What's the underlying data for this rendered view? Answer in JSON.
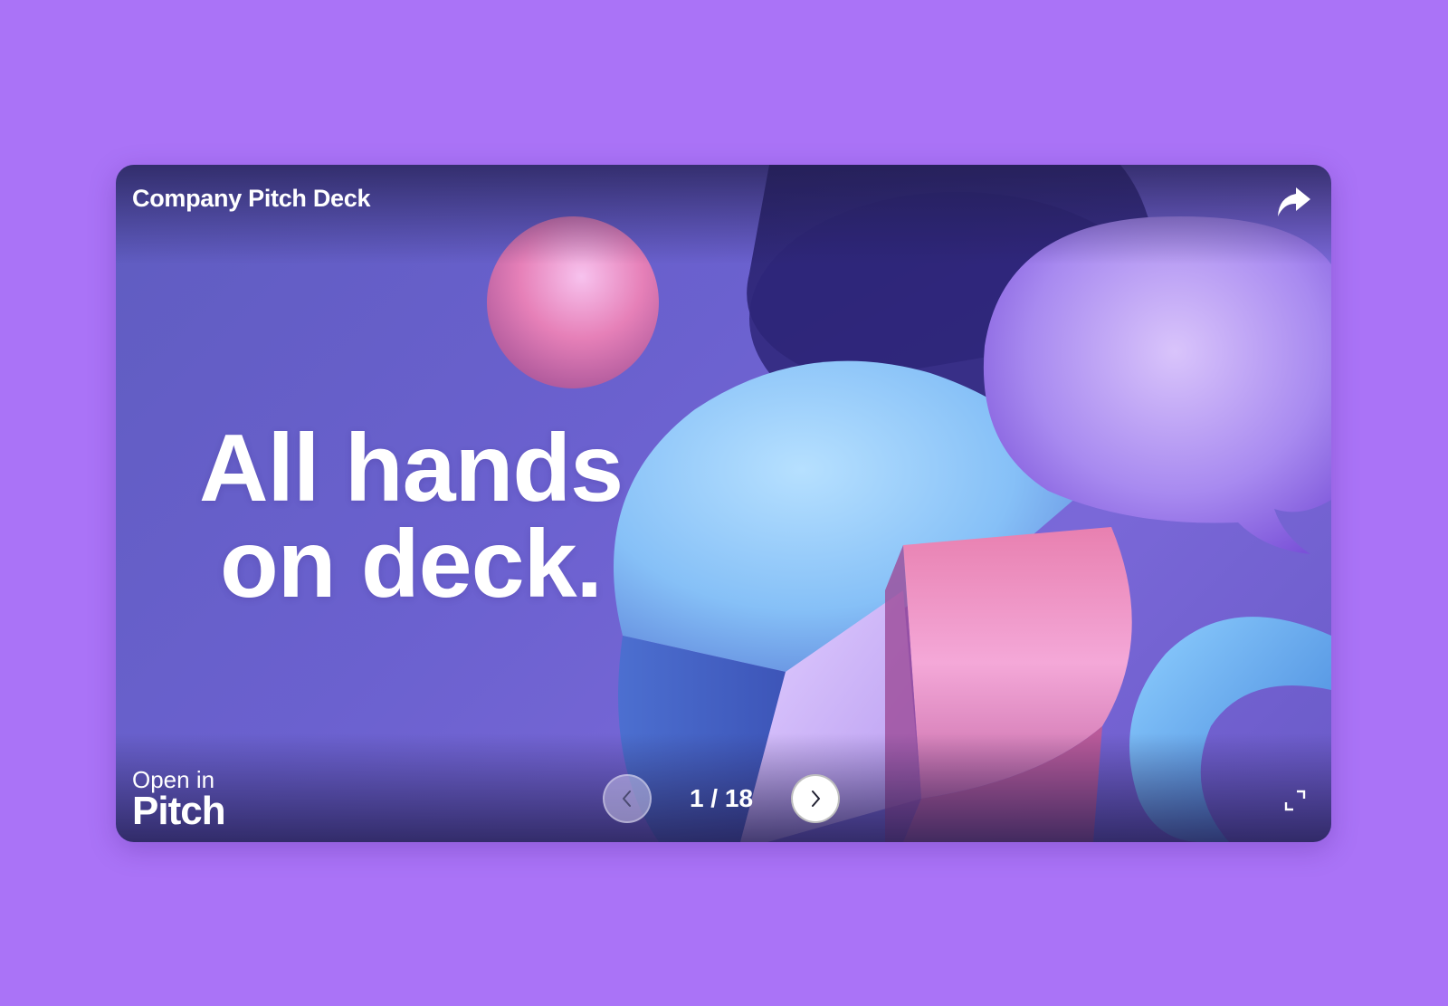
{
  "window": {
    "title": "Company Pitch Deck"
  },
  "slide": {
    "headline_line1": "All hands",
    "headline_line2": "on deck."
  },
  "footer": {
    "open_in_label": "Open in",
    "brand_label": "Pitch"
  },
  "pagination": {
    "current": "1",
    "separator": " / ",
    "total": "18"
  },
  "icons": {
    "share": "share-arrow-icon",
    "prev": "chevron-left-icon",
    "next": "chevron-right-icon",
    "fullscreen": "fullscreen-icon"
  },
  "colors": {
    "background": "#aa73f7",
    "slide_base": "#6b61cf",
    "text": "#ffffff"
  }
}
